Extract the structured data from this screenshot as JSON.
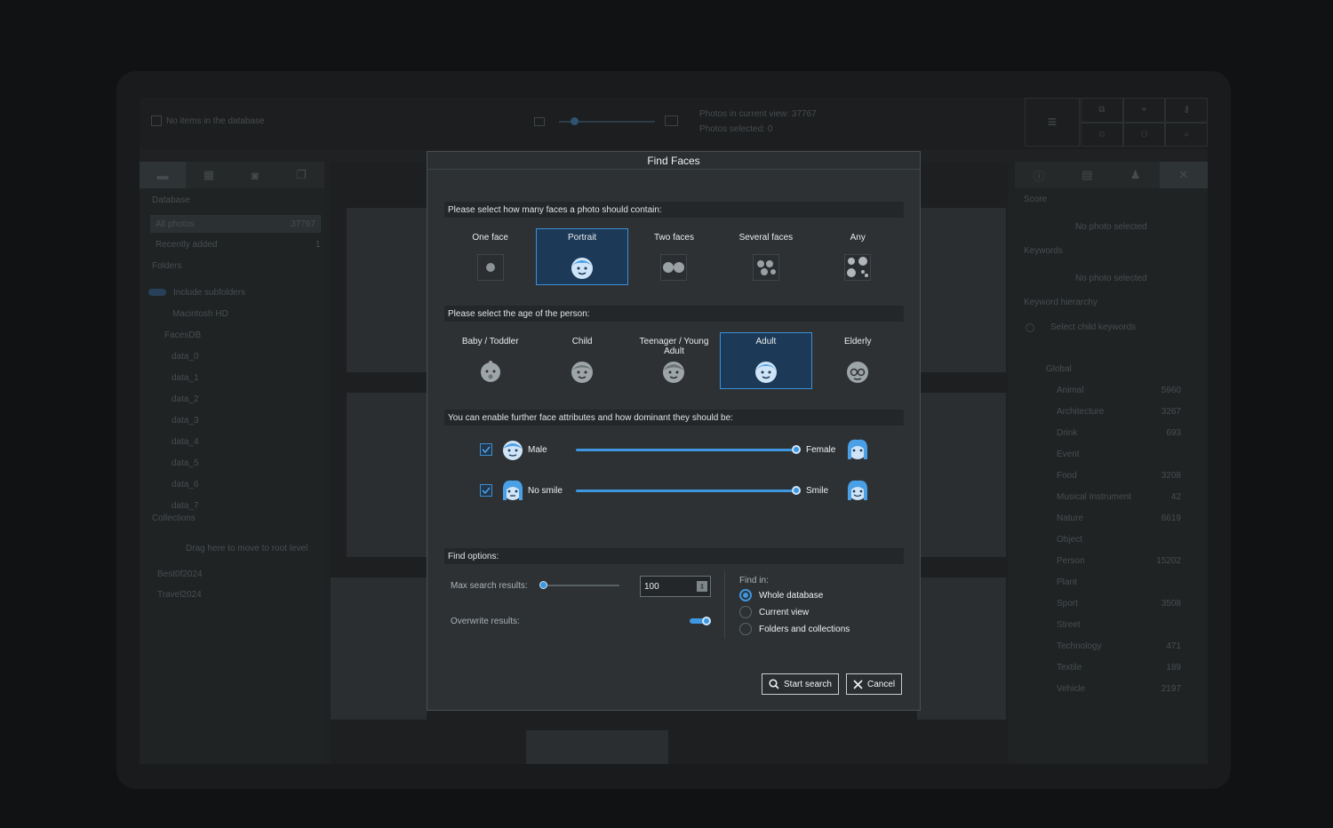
{
  "background_app": {
    "top": {
      "no_items": "No items in the database",
      "photos_in_view": "Photos in current view: 37767",
      "photos_selected": "Photos selected: 0"
    },
    "left": {
      "database_header": "Database",
      "all_photos": "All photos",
      "all_photos_count": "37767",
      "recently_added": "Recently added",
      "recently_added_count": "1",
      "folders_header": "Folders",
      "include_subfolders": "Include subfolders",
      "macintosh_hd": "Macintosh HD",
      "faces_folder": "FacesDB",
      "subfolders": [
        "data_0",
        "data_1",
        "data_2",
        "data_3",
        "data_4",
        "data_5",
        "data_6",
        "data_7"
      ],
      "collections_header": "Collections",
      "drag_hint": "Drag here to move to root level",
      "collections": [
        "Best0f2024",
        "Travel2024"
      ]
    },
    "right": {
      "score_header": "Score",
      "no_photo_1": "No photo selected",
      "keywords_header": "Keywords",
      "no_photo_2": "No photo selected",
      "hierarchy_header": "Keyword hierarchy",
      "select_child": "Select child keywords",
      "global": "Global",
      "keywords": [
        {
          "name": "Animal",
          "count": "5960"
        },
        {
          "name": "Architecture",
          "count": "3267"
        },
        {
          "name": "Drink",
          "count": "693"
        },
        {
          "name": "Event",
          "count": ""
        },
        {
          "name": "Food",
          "count": "3208"
        },
        {
          "name": "Musical Instrument",
          "count": "42"
        },
        {
          "name": "Nature",
          "count": "6619"
        },
        {
          "name": "Object",
          "count": ""
        },
        {
          "name": "Person",
          "count": "15202"
        },
        {
          "name": "Plant",
          "count": ""
        },
        {
          "name": "Sport",
          "count": "3508"
        },
        {
          "name": "Street",
          "count": ""
        },
        {
          "name": "Technology",
          "count": "471"
        },
        {
          "name": "Textile",
          "count": "189"
        },
        {
          "name": "Vehicle",
          "count": "2197"
        }
      ]
    }
  },
  "dialog": {
    "title": "Find Faces",
    "faces_section": "Please select how many faces a photo should contain:",
    "face_options": [
      {
        "label": "One face",
        "selected": false
      },
      {
        "label": "Portrait",
        "selected": true
      },
      {
        "label": "Two faces",
        "selected": false
      },
      {
        "label": "Several faces",
        "selected": false
      },
      {
        "label": "Any",
        "selected": false
      }
    ],
    "age_section": "Please select the age of the person:",
    "age_options": [
      {
        "label": "Baby / Toddler",
        "selected": false
      },
      {
        "label": "Child",
        "selected": false
      },
      {
        "label": "Teenager / Young Adult",
        "selected": false
      },
      {
        "label": "Adult",
        "selected": true
      },
      {
        "label": "Elderly",
        "selected": false
      }
    ],
    "attr_section": "You can enable further face attributes and how dominant they should be:",
    "attributes": [
      {
        "left": "Male",
        "right": "Female",
        "checked": true,
        "value": 1.0
      },
      {
        "left": "No smile",
        "right": "Smile",
        "checked": true,
        "value": 1.0
      }
    ],
    "options_section": "Find options:",
    "max_results_label": "Max search results:",
    "max_results_value": "100",
    "max_results_slider": 0.0,
    "overwrite_label": "Overwrite results:",
    "overwrite_on": true,
    "find_in_label": "Find in:",
    "find_in": [
      {
        "label": "Whole database",
        "selected": true
      },
      {
        "label": "Current view",
        "selected": false
      },
      {
        "label": "Folders and collections",
        "selected": false
      }
    ],
    "start_search": "Start search",
    "cancel": "Cancel"
  },
  "colors": {
    "accent": "#3e97e0",
    "selected_bg": "#1c3a57",
    "dialog_bg": "#2d3133"
  }
}
